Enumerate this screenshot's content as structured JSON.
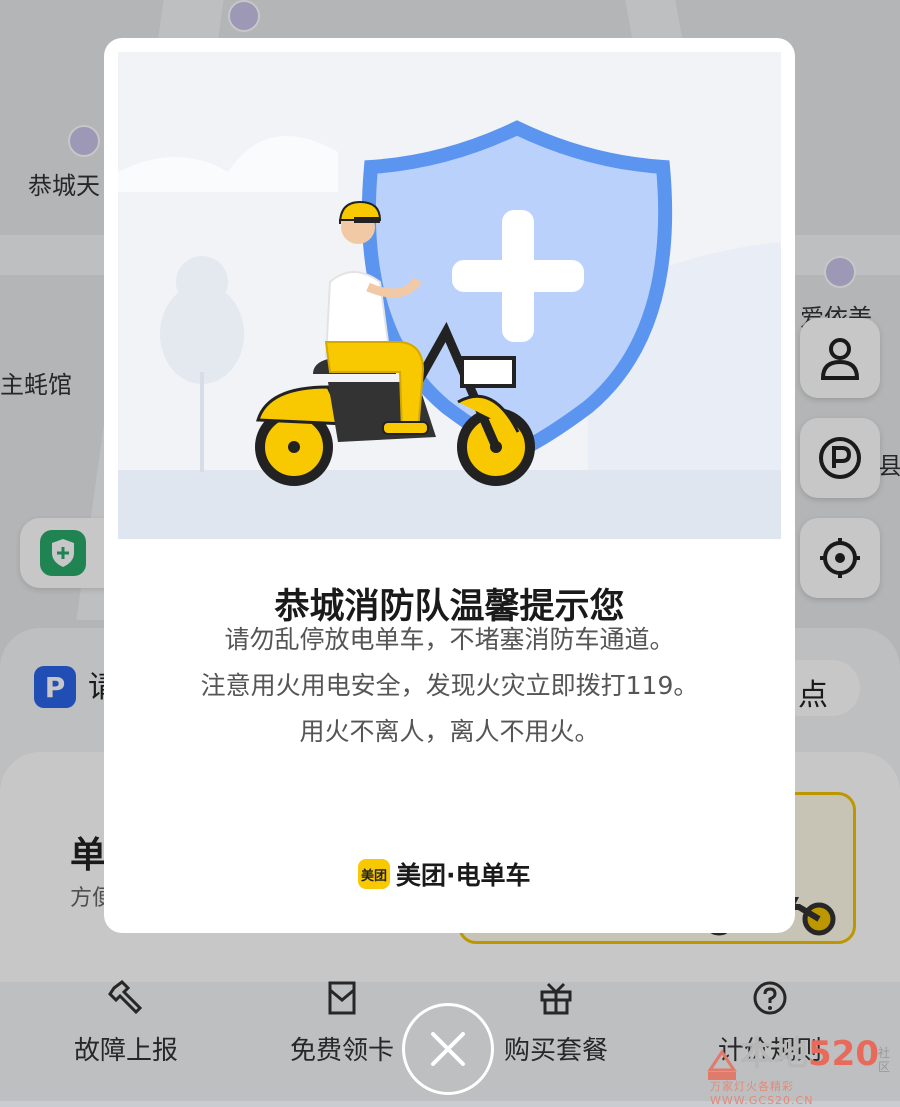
{
  "map": {
    "poi_labels": [
      "恭城天",
      "主蚝馆",
      "爱依美",
      "县"
    ]
  },
  "bottom_sheet": {
    "parking_label": "请",
    "parking_badge": "P",
    "nearby_chip": "点",
    "card_title": "单",
    "card_subtitle": "方便"
  },
  "actions": [
    {
      "label": "故障上报",
      "icon": "wrench-icon"
    },
    {
      "label": "免费领卡",
      "icon": "card-icon"
    },
    {
      "label": "购买套餐",
      "icon": "gift-icon"
    },
    {
      "label": "计价规则",
      "icon": "question-icon"
    }
  ],
  "modal": {
    "title": "恭城消防队温馨提示您",
    "lines": [
      "请勿乱停放电单车，不堵塞消防车通道。",
      "注意用火用电安全，发现火灾立即拨打119。",
      "用火不离人，离人不用火。"
    ],
    "brand_badge": "美团",
    "brand_name": "美团·电单车"
  },
  "watermark": {
    "brand": "本地",
    "number": "520",
    "tag": "社区",
    "caption": "万家灯火各精彩 WWW.GCS20.CN"
  },
  "colors": {
    "brand_yellow": "#f8c800",
    "shield_blue": "#5b95f0",
    "guard_green": "#2aa96a",
    "parking_blue": "#2a64e8"
  }
}
